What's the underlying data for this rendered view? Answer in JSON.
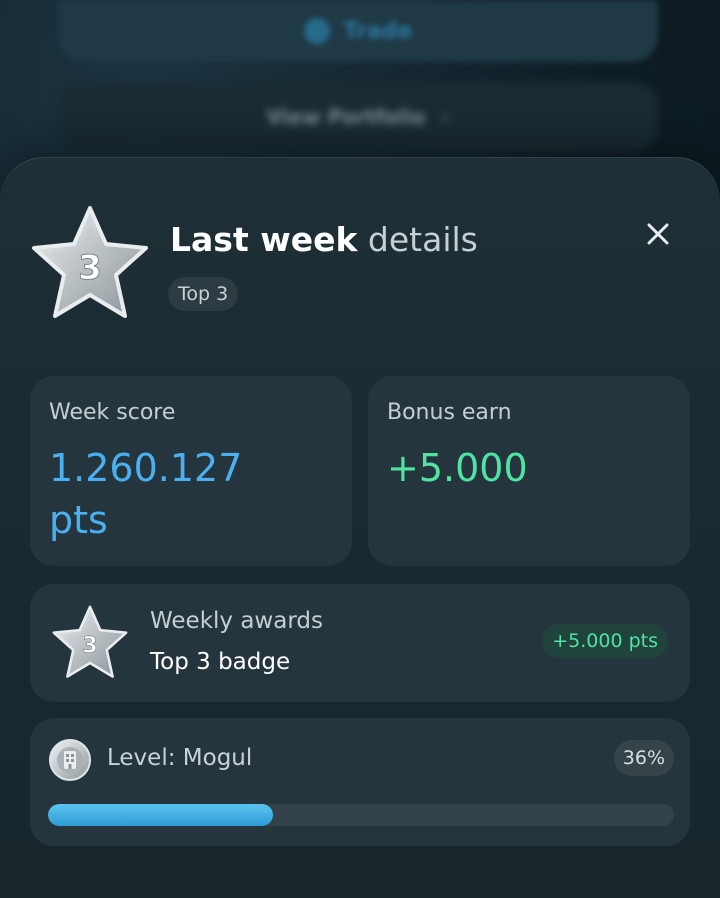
{
  "background": {
    "primary_button_label": "Trade",
    "secondary_button_label": "View Portfolio"
  },
  "sheet": {
    "title_bold": "Last week",
    "title_light": "details",
    "rank_chip": "Top 3",
    "rank_number": "3",
    "close_icon": "close-icon"
  },
  "stats": {
    "score_label": "Week score",
    "score_value": "1.260.127 pts",
    "bonus_label": "Bonus earn",
    "bonus_value": "+5.000"
  },
  "awards": {
    "title": "Weekly awards",
    "name": "Top 3 badge",
    "badge_number": "3",
    "points_chip": "+5.000 pts"
  },
  "level": {
    "label": "Level: Mogul",
    "percent_label": "36%",
    "progress": 0.36
  },
  "colors": {
    "accent_blue": "#4ab0ef",
    "accent_green": "#4fe3a4",
    "sheet_bg": "#1e2f37",
    "card_bg": "#25353d"
  }
}
